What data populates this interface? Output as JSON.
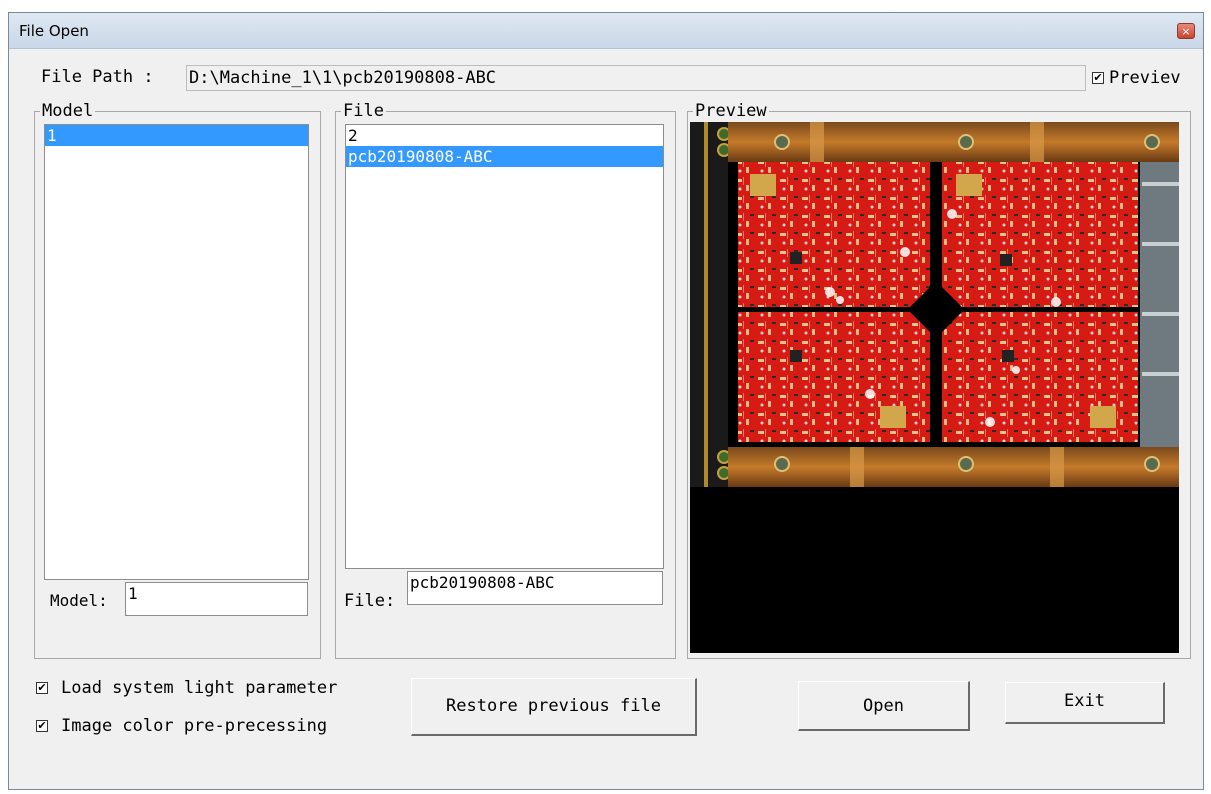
{
  "window": {
    "title": "File Open",
    "close_label": "×"
  },
  "path": {
    "label": "File Path :",
    "value": "D:\\Machine_1\\1\\pcb20190808-ABC"
  },
  "preview_toggle": {
    "label": "Previev",
    "checked": true
  },
  "model_group": {
    "legend": "Model",
    "items": [
      {
        "label": "1",
        "selected": true
      }
    ],
    "field_label": "Model:",
    "field_value": "1"
  },
  "file_group": {
    "legend": "File",
    "items": [
      {
        "label": "2",
        "selected": false
      },
      {
        "label": "pcb20190808-ABC",
        "selected": true
      }
    ],
    "field_label": "File:",
    "field_value": "pcb20190808-ABC"
  },
  "preview_group": {
    "legend": "Preview"
  },
  "options": [
    {
      "label": "Load system light parameter",
      "checked": true
    },
    {
      "label": "Image color pre-precessing",
      "checked": true
    }
  ],
  "buttons": {
    "restore": "Restore previous file",
    "open": "Open",
    "exit": "Exit"
  },
  "check_mark": "✔",
  "colors": {
    "selection": "#3399ff",
    "pcb_red": "#d61a14",
    "fixture_copper": "#b2691f",
    "preview_bg": "#000000"
  }
}
